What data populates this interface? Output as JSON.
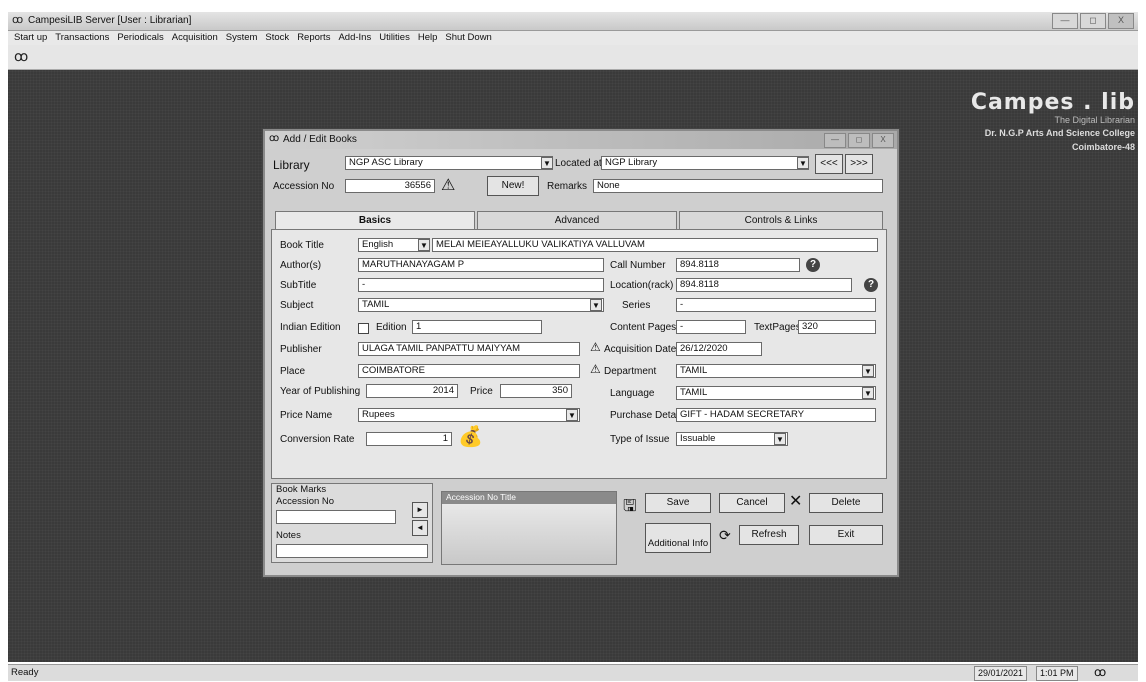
{
  "window": {
    "title": "CampesiLIB Server [User : Librarian]",
    "controls": [
      "—",
      "◻",
      "X"
    ]
  },
  "menu": [
    "Start up",
    "Transactions",
    "Periodicals",
    "Acquisition",
    "System",
    "Stock",
    "Reports",
    "Add-Ins",
    "Utilities",
    "Help",
    "Shut Down"
  ],
  "brand": {
    "logo": "Campes . lib",
    "tagline": "The Digital Librarian",
    "college_line1": "Dr. N.G.P Arts And Science College",
    "college_line2": "Coimbatore-48"
  },
  "status": {
    "ready": "Ready",
    "date": "29/01/2021",
    "time": "1:01 PM"
  },
  "dialog": {
    "title": "Add / Edit Books",
    "library_label": "Library",
    "library_value": "NGP ASC Library",
    "located_label": "Located at",
    "located_value": "NGP Library",
    "prev_label": "<<<",
    "next_label": ">>>",
    "accession_label": "Accession No",
    "accession_value": "36556",
    "new_label": "New!",
    "remarks_label": "Remarks",
    "remarks_value": "None",
    "tabs": [
      "Basics",
      "Advanced",
      "Controls & Links"
    ],
    "basics": {
      "book_title_label": "Book Title",
      "language_value": "English",
      "book_title_value": "MELAI MEIEAYALLUKU VALIKATIYA VALLUVAM",
      "authors_label": "Author(s)",
      "authors_value": "MARUTHANAYAGAM P",
      "call_number_label": "Call Number",
      "call_number_value": "894.8118",
      "subtitle_label": "SubTitle",
      "subtitle_value": "-",
      "location_label": "Location(rack)",
      "location_value": "894.8118",
      "subject_label": "Subject",
      "subject_value": "TAMIL",
      "series_label": "Series",
      "series_value": "-",
      "indian_edition_label": "Indian Edition",
      "edition_label": "Edition",
      "edition_value": "1",
      "content_pages_label": "Content Pages",
      "content_pages_value": "-",
      "text_pages_label": "TextPages",
      "text_pages_value": "320",
      "publisher_label": "Publisher",
      "publisher_value": "ULAGA TAMIL PANPATTU MAIYYAM",
      "acquisition_date_label": "Acquisition Date",
      "acquisition_date_value": "26/12/2020",
      "place_label": "Place",
      "place_value": "COIMBATORE",
      "department_label": "Department",
      "department_value": "TAMIL",
      "year_label": "Year of Publishing",
      "year_value": "2014",
      "price_label": "Price",
      "price_value": "350",
      "language_label": "Language",
      "language_field_value": "TAMIL",
      "price_name_label": "Price Name",
      "price_name_value": "Rupees",
      "purchase_label": "Purchase Details",
      "purchase_value": "GIFT - HADAM SECRETARY",
      "conversion_label": "Conversion Rate",
      "conversion_value": "1",
      "type_issue_label": "Type of Issue",
      "type_issue_value": "Issuable"
    },
    "bookmarks": {
      "group_label": "Book Marks",
      "accession_label": "Accession No",
      "notes_label": "Notes",
      "list_header": "Accession No  Title"
    },
    "buttons": {
      "save": "Save",
      "cancel": "Cancel",
      "delete": "Delete",
      "additional_info": "Additional Info",
      "refresh": "Refresh",
      "exit": "Exit"
    }
  }
}
